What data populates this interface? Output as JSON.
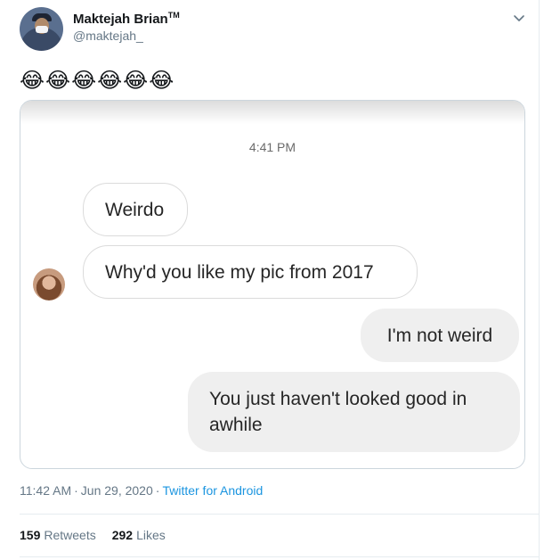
{
  "author": {
    "name": "Maktejah Brian",
    "trademark": "TM",
    "handle": "@maktejah_"
  },
  "tweet_text": "😂😂😂😂😂😂",
  "chat": {
    "time": "4:41 PM",
    "messages": [
      {
        "direction": "incoming",
        "text": "Weirdo"
      },
      {
        "direction": "incoming",
        "text": "Why'd you like my pic from 2017"
      },
      {
        "direction": "outgoing",
        "text": "I'm not weird"
      },
      {
        "direction": "outgoing",
        "text": "You just haven't looked good in awhile"
      }
    ]
  },
  "meta": {
    "time": "11:42 AM",
    "date": "Jun 29, 2020",
    "source": "Twitter for Android"
  },
  "stats": {
    "retweets_count": "159",
    "retweets_label": "Retweets",
    "likes_count": "292",
    "likes_label": "Likes"
  },
  "icons": {
    "menu": "chevron-down-icon"
  },
  "colors": {
    "link": "#1b95e0",
    "secondary_text": "#657786",
    "bubble_outgoing": "#efefef",
    "bubble_incoming_border": "#dbdbdb"
  }
}
